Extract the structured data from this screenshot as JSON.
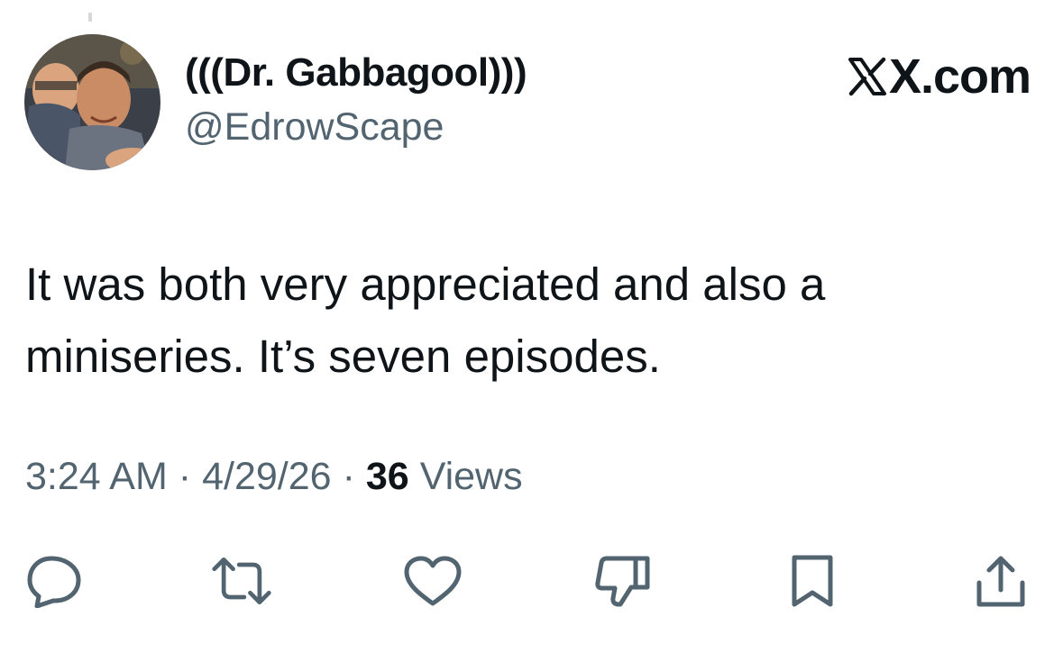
{
  "author": {
    "display_name": "(((Dr. Gabbagool)))",
    "handle": "@EdrowScape",
    "avatar_icon": "profile-photo"
  },
  "brand": {
    "label": "X.com",
    "icon": "x-logo-icon"
  },
  "tweet": {
    "text_line1": "It was both very appreciated and also a",
    "text_line2": "miniseries. It’s seven episodes."
  },
  "meta": {
    "time": "3:24 AM",
    "separator": "·",
    "date": "4/29/26",
    "views_count": "36",
    "views_label": "Views"
  },
  "actions": [
    {
      "name": "reply",
      "icon": "reply-icon"
    },
    {
      "name": "retweet",
      "icon": "retweet-icon"
    },
    {
      "name": "like",
      "icon": "heart-icon"
    },
    {
      "name": "dislike",
      "icon": "thumbs-down-icon"
    },
    {
      "name": "bookmark",
      "icon": "bookmark-icon"
    },
    {
      "name": "share",
      "icon": "share-icon"
    }
  ],
  "colors": {
    "text_primary": "#0f1419",
    "text_secondary": "#536471",
    "icon_gray": "#536471",
    "background": "#ffffff"
  }
}
